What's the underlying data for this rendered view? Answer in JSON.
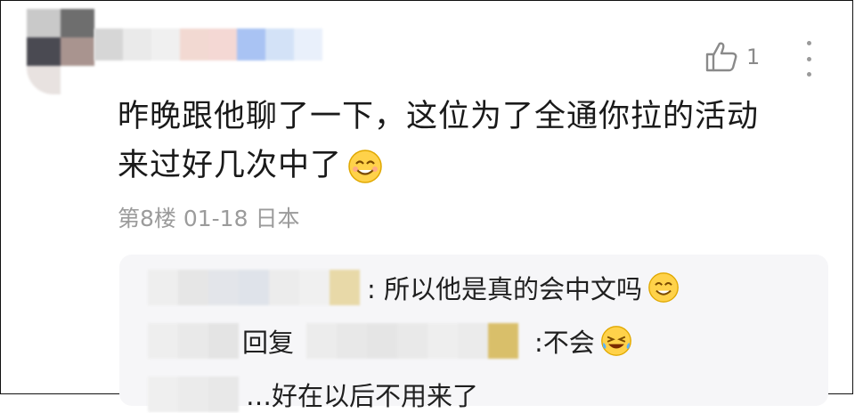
{
  "comment": {
    "line1": "昨晚跟他聊了一下，这位为了全通你拉的活动",
    "line2": "来过好几次中了",
    "emoji": "smile-emoji",
    "like_count": "1",
    "meta": "第8楼 01-18 日本"
  },
  "replies": [
    {
      "text": ": 所以他是真的会中文吗",
      "emoji": "smile-emoji"
    },
    {
      "reply_word": "回复",
      "text": ":不会",
      "emoji": "laugh-cry-emoji"
    },
    {
      "text": "…好在以后不用来了"
    }
  ],
  "colors": {
    "text": "#1a1a1a",
    "meta": "#9b9b9b",
    "reply_bg": "#f6f6f8",
    "icon": "#8a8a8a"
  }
}
